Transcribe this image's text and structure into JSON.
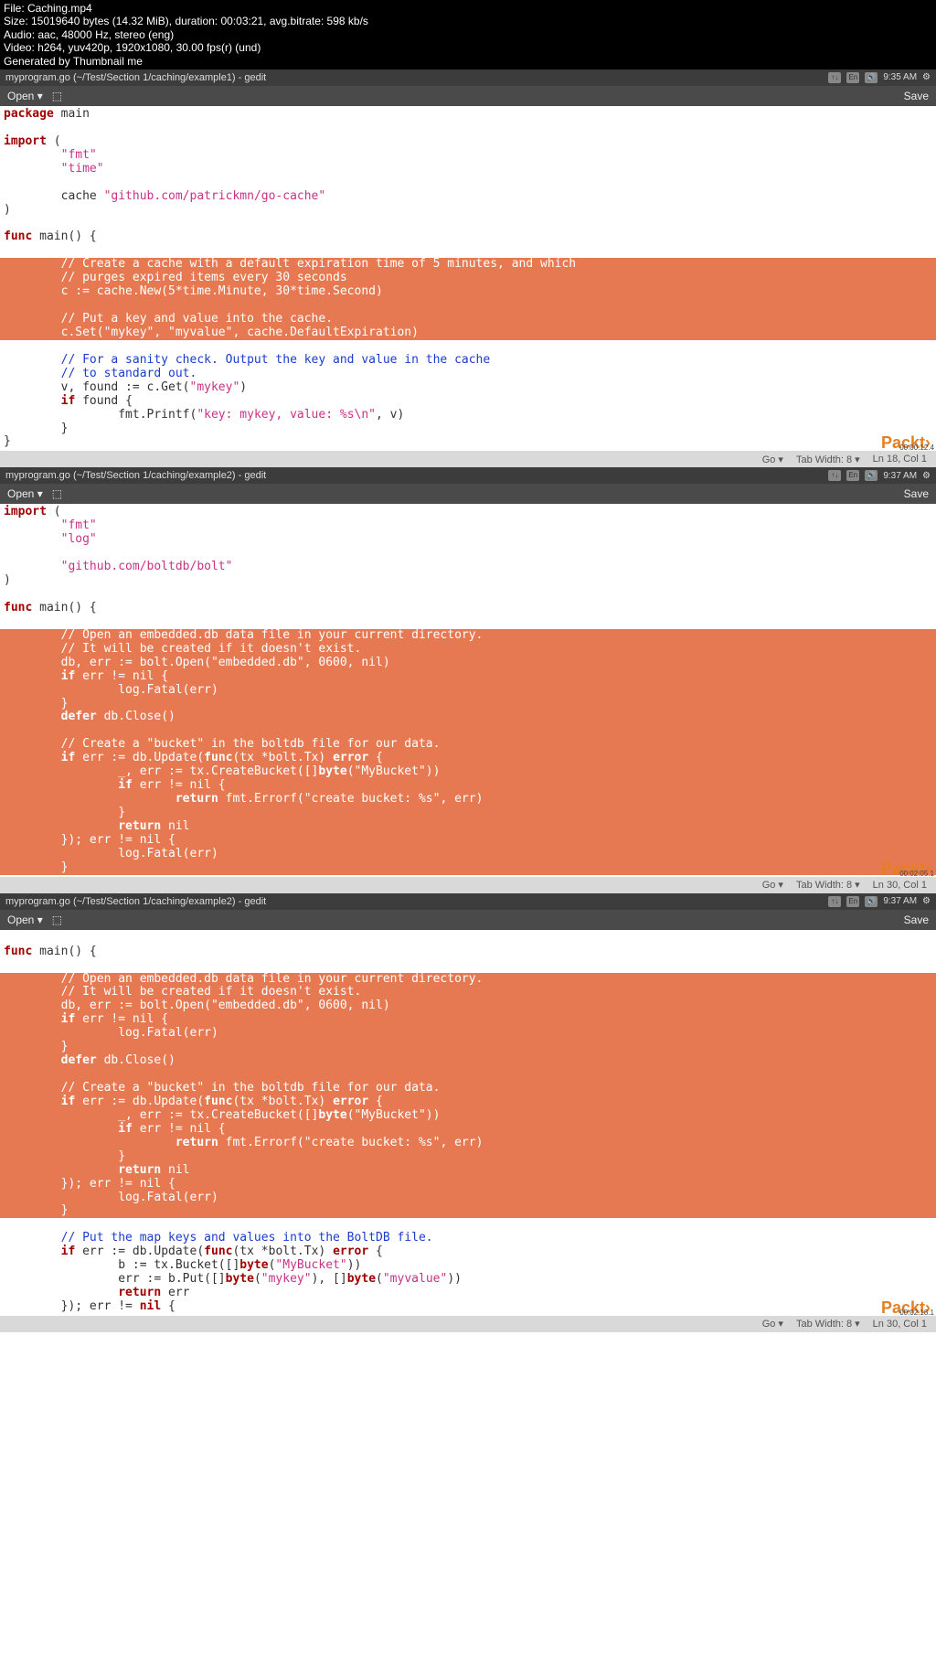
{
  "metadata": {
    "file": "File: Caching.mp4",
    "size": "Size: 15019640 bytes (14.32 MiB), duration: 00:03:21, avg.bitrate: 598 kb/s",
    "audio": "Audio: aac, 48000 Hz, stereo (eng)",
    "video": "Video: h264, yuv420p, 1920x1080, 30.00 fps(r) (und)",
    "generated": "Generated by Thumbnail me"
  },
  "frag1": {
    "titlebar": "myprogram.go (~/Test/Section 1/caching/example1) - gedit",
    "time": "9:35 AM",
    "open": "Open",
    "save": "Save",
    "status_go": "Go ▾",
    "status_tab": "Tab Width: 8 ▾",
    "status_pos": "Ln 18, Col 1",
    "brand": "Packt›",
    "ts": "00:00:12.4",
    "code": {
      "l01_kw": "package",
      "l01_id": " main",
      "l03_kw": "import",
      "l03_id": " (",
      "l04_str": "        \"fmt\"",
      "l05_str": "        \"time\"",
      "l07_id": "        cache ",
      "l07_str": "\"github.com/patrickmn/go-cache\"",
      "l08_id": ")",
      "l10_kw": "func",
      "l10_id": " main() {",
      "h1_l1": "        // Create a cache with a default expiration time of 5 minutes, and which",
      "h1_l2": "        // purges expired items every 30 seconds",
      "h1_l3": "        c := cache.New(5*time.Minute, 30*time.Second)",
      "h1_l4": "",
      "h1_l5": "        // Put a key and value into the cache.",
      "h1_l6": "        c.Set(\"mykey\", \"myvalue\", cache.DefaultExpiration)",
      "l18_cmt": "        // For a sanity check. Output the key and value in the cache",
      "l19_cmt": "        // to standard out.",
      "l20_id": "        v, found := c.Get(",
      "l20_str": "\"mykey\"",
      "l20_id2": ")",
      "l21_kw": "        if",
      "l21_id": " found {",
      "l22_id": "                fmt.Printf(",
      "l22_str": "\"key: mykey, value: %s\\n\"",
      "l22_id2": ", v)",
      "l23_id": "        }",
      "l24_id": "}"
    }
  },
  "frag2": {
    "titlebar": "myprogram.go (~/Test/Section 1/caching/example2) - gedit",
    "time": "9:37 AM",
    "open": "Open",
    "save": "Save",
    "status_go": "Go ▾",
    "status_tab": "Tab Width: 8 ▾",
    "status_pos": "Ln 30, Col 1",
    "brand": "Packt›",
    "ts": "00:02:05.1",
    "code": {
      "l01_kw": "import",
      "l01_id": " (",
      "l02_str": "        \"fmt\"",
      "l03_str": "        \"log\"",
      "l05_str": "        \"github.com/boltdb/bolt\"",
      "l06_id": ")",
      "l08_kw": "func",
      "l08_id": " main() {",
      "h_l1": "        // Open an embedded.db data file in your current directory.",
      "h_l2": "        // It will be created if it doesn't exist.",
      "h_l3": "        db, err := bolt.Open(\"embedded.db\", 0600, nil)",
      "h_l4a": "        ",
      "h_l4_kw": "if",
      "h_l4b": " err != nil {",
      "h_l5": "                log.Fatal(err)",
      "h_l6": "        }",
      "h_l7a": "        ",
      "h_l7_kw": "defer",
      "h_l7b": " db.Close()",
      "h_l8": "",
      "h_l9": "        // Create a \"bucket\" in the boltdb file for our data.",
      "h_l10a": "        ",
      "h_l10_kw1": "if",
      "h_l10b": " err := db.Update(",
      "h_l10_kw2": "func",
      "h_l10c": "(tx *bolt.Tx) ",
      "h_l10_kw3": "error",
      "h_l10d": " {",
      "h_l11a": "                _, err := tx.CreateBucket([]",
      "h_l11_kw": "byte",
      "h_l11b": "(\"MyBucket\"))",
      "h_l12a": "                ",
      "h_l12_kw": "if",
      "h_l12b": " err != nil {",
      "h_l13a": "                        ",
      "h_l13_kw": "return",
      "h_l13b": " fmt.Errorf(\"create bucket: %s\", err)",
      "h_l14": "                }",
      "h_l15a": "                ",
      "h_l15_kw": "return",
      "h_l15b": " nil",
      "h_l16": "        }); err != nil {",
      "h_l17": "                log.Fatal(err)",
      "h_l18": "        }"
    }
  },
  "frag3": {
    "titlebar": "myprogram.go (~/Test/Section 1/caching/example2) - gedit",
    "time": "9:37 AM",
    "open": "Open",
    "save": "Save",
    "status_go": "Go ▾",
    "status_tab": "Tab Width: 8 ▾",
    "status_pos": "Ln 30, Col 1",
    "brand": "Packt›",
    "ts": "00:02:18.1",
    "code": {
      "l01_kw": "func",
      "l01_id": " main() {",
      "h_l1": "        // Open an embedded.db data file in your current directory.",
      "h_l2": "        // It will be created if it doesn't exist.",
      "h_l3": "        db, err := bolt.Open(\"embedded.db\", 0600, nil)",
      "h_l4a": "        ",
      "h_l4_kw": "if",
      "h_l4b": " err != nil {",
      "h_l5": "                log.Fatal(err)",
      "h_l6": "        }",
      "h_l7a": "        ",
      "h_l7_kw": "defer",
      "h_l7b": " db.Close()",
      "h_l8": "",
      "h_l9": "        // Create a \"bucket\" in the boltdb file for our data.",
      "h_l10a": "        ",
      "h_l10_kw1": "if",
      "h_l10b": " err := db.Update(",
      "h_l10_kw2": "func",
      "h_l10c": "(tx *bolt.Tx) ",
      "h_l10_kw3": "error",
      "h_l10d": " {",
      "h_l11a": "                _, err := tx.CreateBucket([]",
      "h_l11_kw": "byte",
      "h_l11b": "(\"MyBucket\"))",
      "h_l12a": "                ",
      "h_l12_kw": "if",
      "h_l12b": " err != nil {",
      "h_l13a": "                        ",
      "h_l13_kw": "return",
      "h_l13b": " fmt.Errorf(\"create bucket: %s\", err)",
      "h_l14": "                }",
      "h_l15a": "                ",
      "h_l15_kw": "return",
      "h_l15b": " nil",
      "h_l16": "        }); err != nil {",
      "h_l17": "                log.Fatal(err)",
      "h_l18": "        }",
      "l20_cmt": "        // Put the map keys and values into the BoltDB file.",
      "l21a": "        ",
      "l21_kw1": "if",
      "l21b": " err := db.Update(",
      "l21_kw2": "func",
      "l21c": "(tx *bolt.Tx) ",
      "l21_kw3": "error",
      "l21d": " {",
      "l22a": "                b := tx.Bucket([]",
      "l22_kw": "byte",
      "l22b": "(",
      "l22_str": "\"MyBucket\"",
      "l22c": "))",
      "l23a": "                err := b.Put([]",
      "l23_kw1": "byte",
      "l23b": "(",
      "l23_str1": "\"mykey\"",
      "l23c": "), []",
      "l23_kw2": "byte",
      "l23d": "(",
      "l23_str2": "\"myvalue\"",
      "l23e": "))",
      "l24a": "                ",
      "l24_kw": "return",
      "l24b": " err",
      "l25a": "        }); err != ",
      "l25_kw": "nil",
      "l25b": " {"
    }
  },
  "indicators": {
    "lang": "En"
  }
}
